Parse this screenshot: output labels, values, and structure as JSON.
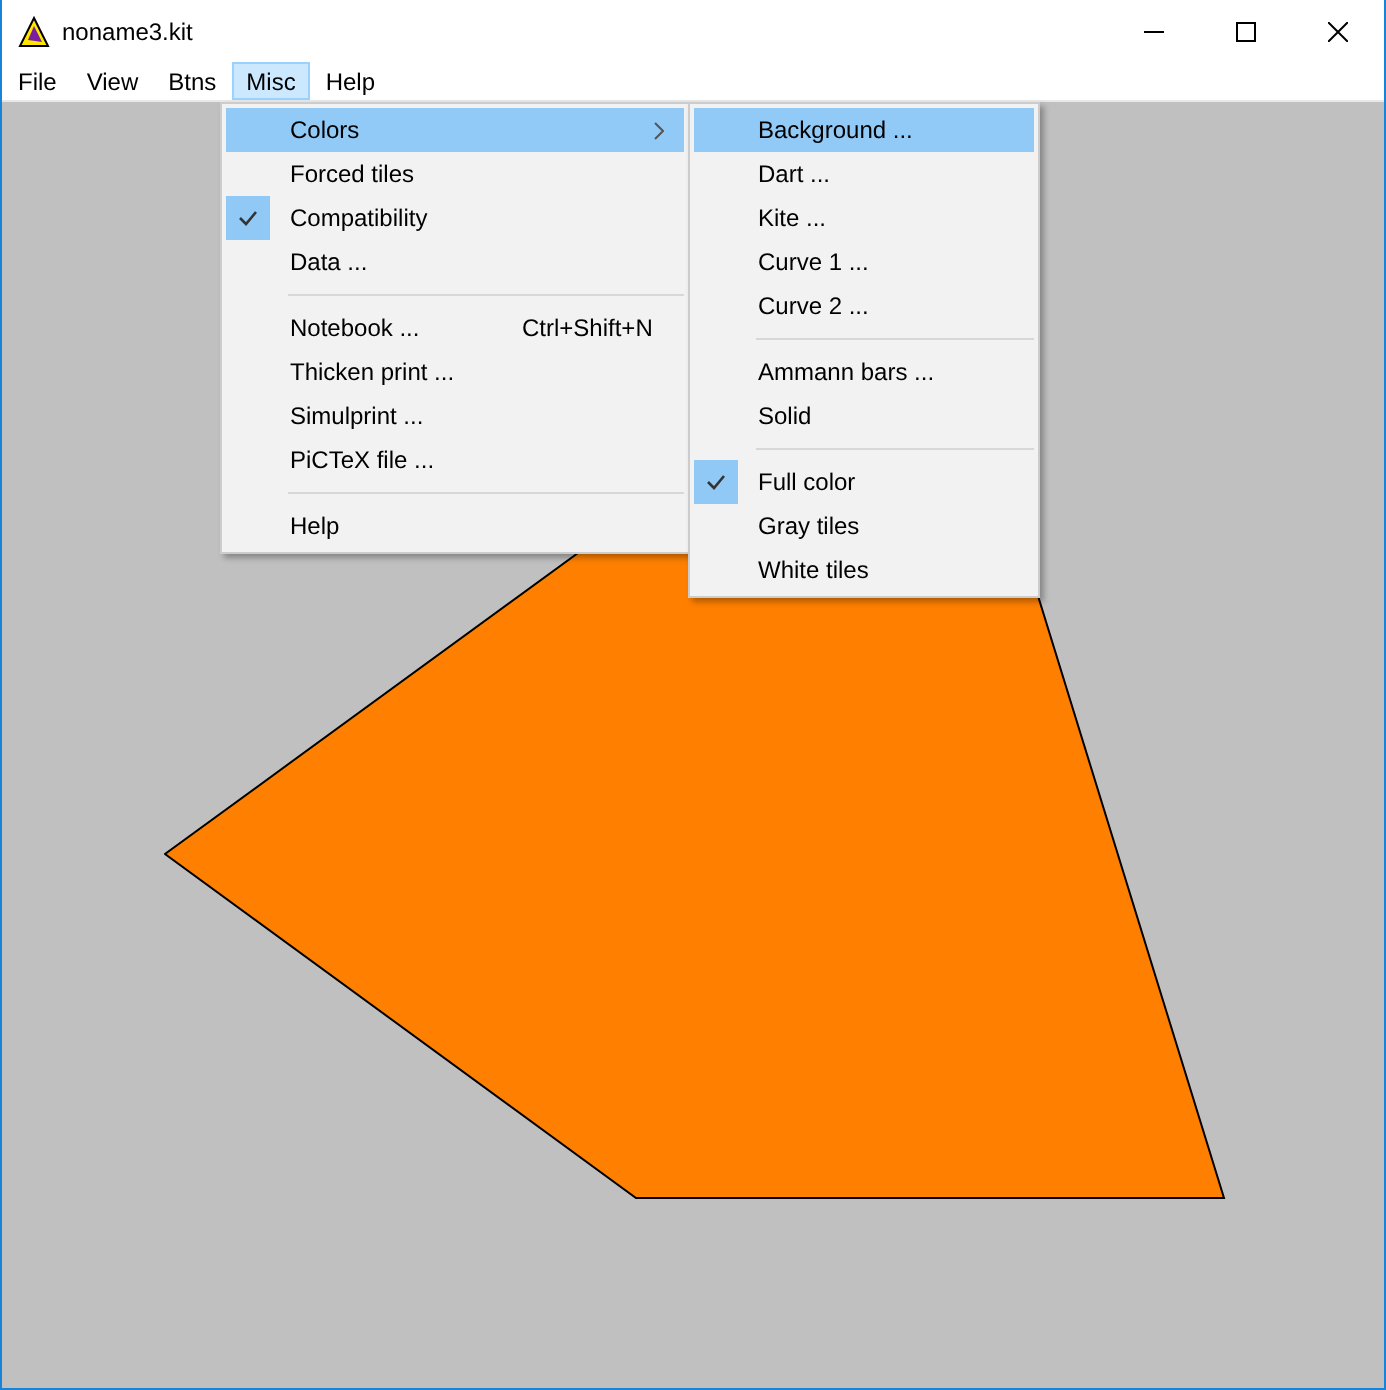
{
  "window": {
    "title": "noname3.kit"
  },
  "menubar": [
    {
      "label": "File",
      "selected": false
    },
    {
      "label": "View",
      "selected": false
    },
    {
      "label": "Btns",
      "selected": false
    },
    {
      "label": "Misc",
      "selected": true
    },
    {
      "label": "Help",
      "selected": false
    }
  ],
  "menu": [
    {
      "kind": "item",
      "label": "Colors",
      "selected": true,
      "checked": false,
      "submenu": true
    },
    {
      "kind": "item",
      "label": "Forced tiles",
      "selected": false,
      "checked": false,
      "submenu": false
    },
    {
      "kind": "item",
      "label": "Compatibility",
      "selected": false,
      "checked": true,
      "submenu": false
    },
    {
      "kind": "item",
      "label": "Data ...",
      "selected": false,
      "checked": false,
      "submenu": false
    },
    {
      "kind": "separator"
    },
    {
      "kind": "item",
      "label": "Notebook ...",
      "shortcut": "Ctrl+Shift+N",
      "selected": false,
      "checked": false,
      "submenu": false
    },
    {
      "kind": "item",
      "label": "Thicken print ...",
      "selected": false,
      "checked": false,
      "submenu": false
    },
    {
      "kind": "item",
      "label": "Simulprint ...",
      "selected": false,
      "checked": false,
      "submenu": false
    },
    {
      "kind": "item",
      "label": "PiCTeX file ...",
      "selected": false,
      "checked": false,
      "submenu": false
    },
    {
      "kind": "separator"
    },
    {
      "kind": "item",
      "label": "Help",
      "selected": false,
      "checked": false,
      "submenu": false
    }
  ],
  "submenu": [
    {
      "kind": "item",
      "label": "Background ...",
      "selected": true,
      "checked": false
    },
    {
      "kind": "item",
      "label": "Dart ...",
      "selected": false,
      "checked": false
    },
    {
      "kind": "item",
      "label": "Kite ...",
      "selected": false,
      "checked": false
    },
    {
      "kind": "item",
      "label": "Curve 1 ...",
      "selected": false,
      "checked": false
    },
    {
      "kind": "item",
      "label": "Curve 2 ...",
      "selected": false,
      "checked": false
    },
    {
      "kind": "separator"
    },
    {
      "kind": "item",
      "label": "Ammann bars ...",
      "selected": false,
      "checked": false
    },
    {
      "kind": "item",
      "label": "Solid",
      "selected": false,
      "checked": false
    },
    {
      "kind": "separator"
    },
    {
      "kind": "item",
      "label": "Full color",
      "selected": false,
      "checked": true
    },
    {
      "kind": "item",
      "label": "Gray tiles",
      "selected": false,
      "checked": false
    },
    {
      "kind": "item",
      "label": "White tiles",
      "selected": false,
      "checked": false
    }
  ]
}
